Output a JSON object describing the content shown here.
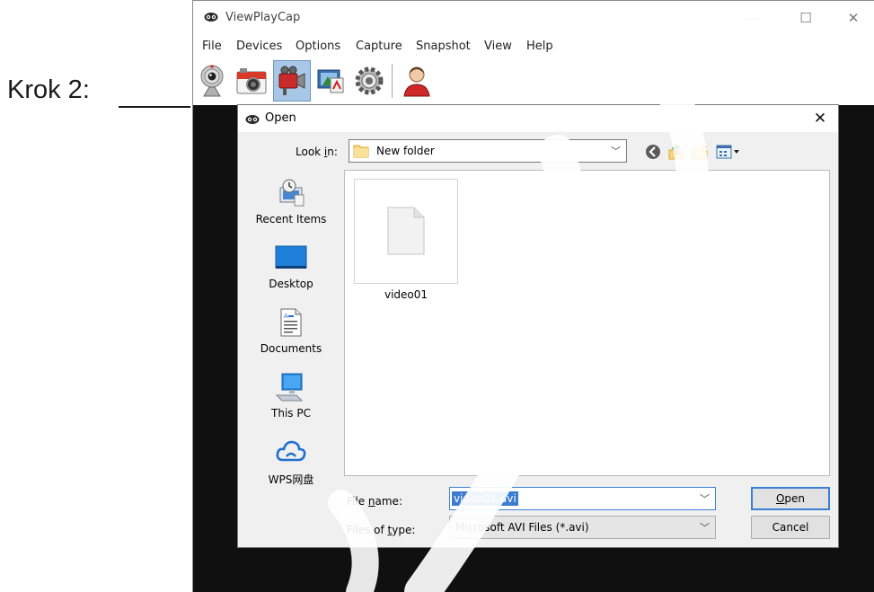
{
  "annotation": {
    "label": "Krok 2:"
  },
  "app": {
    "title": "ViewPlayCap",
    "window_controls": {
      "minimize": "—",
      "maximize": "☐",
      "close": "✕"
    },
    "menu": [
      "File",
      "Devices",
      "Options",
      "Capture",
      "Snapshot",
      "View",
      "Help"
    ],
    "toolbar": [
      "webcam-icon",
      "camera-icon",
      "video-camera-icon",
      "video-properties-icon",
      "settings-gear-icon",
      "user-icon"
    ]
  },
  "dialog": {
    "title": "Open",
    "close": "✕",
    "look_in": {
      "label_pre": "Look ",
      "label_key": "i",
      "label_post": "n:",
      "value": "New folder"
    },
    "places": [
      {
        "label": "Recent Items",
        "icon": "recent-items-icon"
      },
      {
        "label": "Desktop",
        "icon": "desktop-icon"
      },
      {
        "label": "Documents",
        "icon": "documents-icon"
      },
      {
        "label": "This PC",
        "icon": "this-pc-icon"
      },
      {
        "label": "WPS网盘",
        "icon": "wps-cloud-icon"
      }
    ],
    "files": [
      {
        "name": "video01"
      }
    ],
    "file_name": {
      "label_pre": "File ",
      "label_key": "n",
      "label_post": "ame:",
      "value": "video01.avi"
    },
    "file_type": {
      "label_pre": "Files of ",
      "label_key": "t",
      "label_post": "ype:",
      "value": "Microsoft AVI Files (*.avi)"
    },
    "buttons": {
      "open_key": "O",
      "open_rest": "pen",
      "cancel": "Cancel"
    }
  },
  "colors": {
    "accent": "#3b7bd0",
    "video_background": "#101010",
    "dialog_background": "#f0f0f0"
  }
}
